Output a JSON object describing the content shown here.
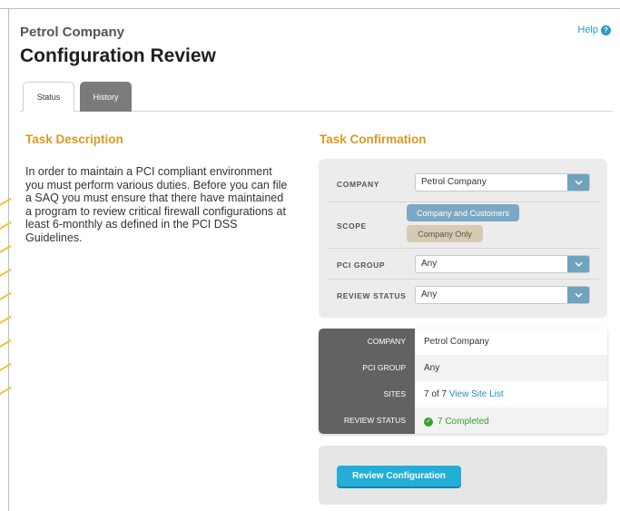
{
  "header": {
    "company": "Petrol Company",
    "title": "Configuration Review",
    "help": "Help"
  },
  "tabs": [
    {
      "label": "Status",
      "active": true
    },
    {
      "label": "History",
      "active": false
    }
  ],
  "description": {
    "title": "Task Description",
    "text": "In order to maintain a PCI compliant environment you must perform various duties. Before you can file a SAQ you must ensure that there have maintained a program to review critical firewall configurations at least 6-monthly as defined in the PCI DSS Guidelines."
  },
  "confirmation": {
    "title": "Task Confirmation",
    "company": {
      "label": "COMPANY",
      "value": "Petrol Company"
    },
    "scope": {
      "label": "SCOPE",
      "options": [
        "Company and Customers",
        "Company Only"
      ],
      "selected": "Company and Customers"
    },
    "pci_group": {
      "label": "PCI GROUP",
      "value": "Any"
    },
    "review_status": {
      "label": "REVIEW STATUS",
      "value": "Any"
    }
  },
  "summary": {
    "company": {
      "label": "COMPANY",
      "value": "Petrol Company"
    },
    "pci_group": {
      "label": "PCI GROUP",
      "value": "Any"
    },
    "sites": {
      "label": "SITES",
      "count": "7 of 7",
      "link": "View Site List"
    },
    "review_status": {
      "label": "REVIEW STATUS",
      "value": "7 Completed"
    }
  },
  "actions": {
    "review_button": "Review Configuration"
  },
  "colors": {
    "accent_orange": "#d89a22",
    "primary_blue": "#22aed6",
    "link_blue": "#1e8fc3",
    "success_green": "#3aa02c",
    "label_dark": "#626262"
  }
}
